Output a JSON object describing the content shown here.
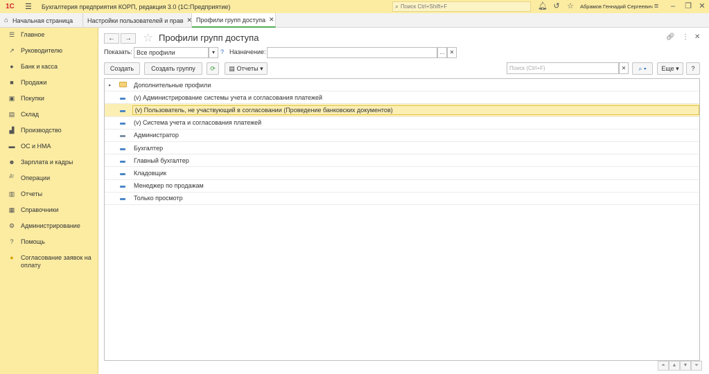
{
  "app": {
    "logo": "1С",
    "title": "Бухгалтерия предприятия КОРП, редакция 3.0  (1С:Предприятие)",
    "search_placeholder": "Поиск Ctrl+Shift+F",
    "user": "Абрамов Геннадий Сергеевич"
  },
  "tabs": [
    {
      "label": "Начальная страница"
    },
    {
      "label": "Настройки пользователей и прав"
    },
    {
      "label": "Профили групп доступа"
    }
  ],
  "sidebar": {
    "items": [
      {
        "label": "Главное",
        "icon": "menu-lines-icon"
      },
      {
        "label": "Руководителю",
        "icon": "trend-icon"
      },
      {
        "label": "Банк и касса",
        "icon": "coin-icon"
      },
      {
        "label": "Продажи",
        "icon": "bag-icon"
      },
      {
        "label": "Покупки",
        "icon": "basket-icon"
      },
      {
        "label": "Склад",
        "icon": "warehouse-icon"
      },
      {
        "label": "Производство",
        "icon": "factory-icon"
      },
      {
        "label": "ОС и НМА",
        "icon": "truck-icon"
      },
      {
        "label": "Зарплата и кадры",
        "icon": "person-icon"
      },
      {
        "label": "Операции",
        "icon": "dt-kt-icon"
      },
      {
        "label": "Отчеты",
        "icon": "bar-chart-icon"
      },
      {
        "label": "Справочники",
        "icon": "book-icon"
      },
      {
        "label": "Администрирование",
        "icon": "gear-icon"
      },
      {
        "label": "Помощь",
        "icon": "question-icon"
      },
      {
        "label": "Согласование заявок на оплату",
        "icon": "approval-icon"
      }
    ]
  },
  "form": {
    "title": "Профили групп доступа",
    "show_label": "Показать:",
    "show_value": "Все профили",
    "help_q": "?",
    "purpose_label": "Назначение:",
    "purpose_value": "",
    "buttons": {
      "create": "Создать",
      "create_group": "Создать группу",
      "reports": "Отчеты",
      "more": "Еще",
      "help": "?"
    },
    "search_placeholder": "Поиск (Ctrl+F)"
  },
  "list": {
    "rows": [
      {
        "label": "Дополнительные профили",
        "type": "folder"
      },
      {
        "label": "(v) Администрирование системы учета и согласования платежей",
        "type": "item"
      },
      {
        "label": "(v) Пользователь, не участвующий в согласовании (Проведение банковских документов)",
        "type": "item",
        "selected": true
      },
      {
        "label": "(v) Система учета и согласования платежей",
        "type": "item"
      },
      {
        "label": "Администратор",
        "type": "admin"
      },
      {
        "label": "Бухгалтер",
        "type": "item"
      },
      {
        "label": "Главный бухгалтер",
        "type": "item"
      },
      {
        "label": "Кладовщик",
        "type": "item"
      },
      {
        "label": "Менеджер по продажам",
        "type": "item"
      },
      {
        "label": "Только просмотр",
        "type": "item"
      }
    ]
  }
}
